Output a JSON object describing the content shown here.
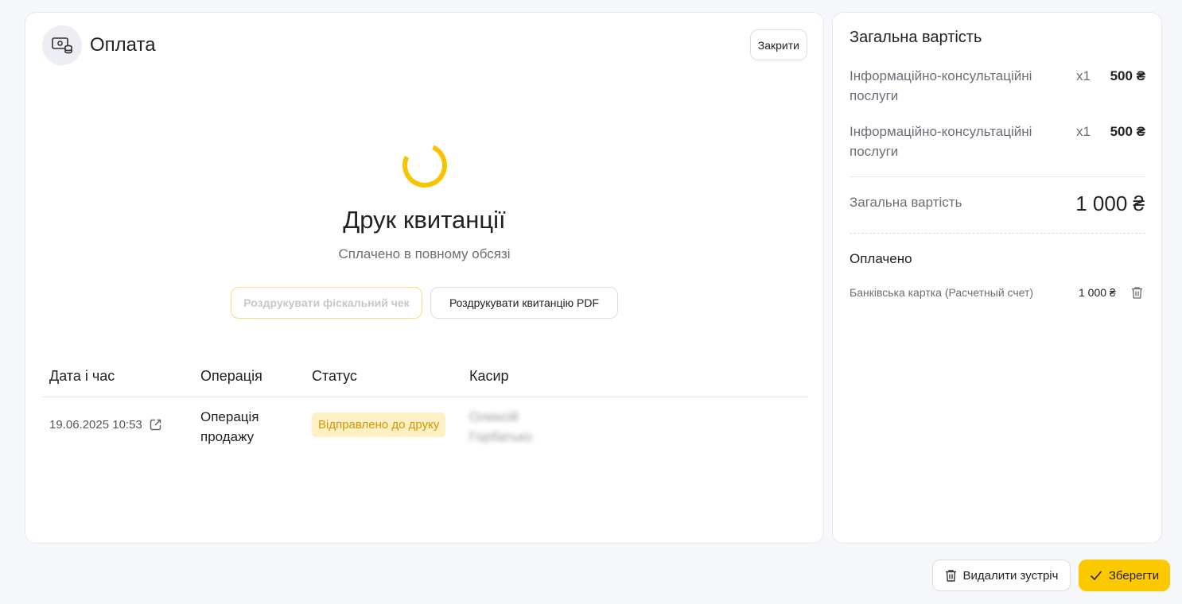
{
  "header": {
    "title": "Оплата",
    "close_label": "Закрити"
  },
  "receipt": {
    "title": "Друк квитанції",
    "subtitle": "Сплачено в повному обсязі",
    "fiscal_button": "Роздрукувати фіскальний чек",
    "pdf_button": "Роздрукувати квитанцію PDF"
  },
  "table": {
    "headers": [
      "Дата і час",
      "Операція",
      "Статус",
      "Касир"
    ],
    "rows": [
      {
        "datetime": "19.06.2025 10:53",
        "operation": "Операція продажу",
        "status": "Відправлено до друку",
        "cashier": "Олексій Горбатько"
      }
    ]
  },
  "summary": {
    "title": "Загальна вартість",
    "items": [
      {
        "name": "Інформаційно-консультаційні послуги",
        "qty": "x1",
        "price": "500 ₴"
      },
      {
        "name": "Інформаційно-консультаційні послуги",
        "qty": "x1",
        "price": "500 ₴"
      }
    ],
    "total_label": "Загальна вартість",
    "total_value": "1 000 ₴",
    "paid_title": "Оплачено",
    "payments": [
      {
        "method": "Банківська картка (Расчетный счет)",
        "amount": "1 000 ₴"
      }
    ]
  },
  "footer": {
    "delete_label": "Видалити зустріч",
    "save_label": "Зберегти"
  },
  "colors": {
    "accent": "#fcc900",
    "status_bg": "#fdf1c5",
    "status_text": "#d79400"
  }
}
